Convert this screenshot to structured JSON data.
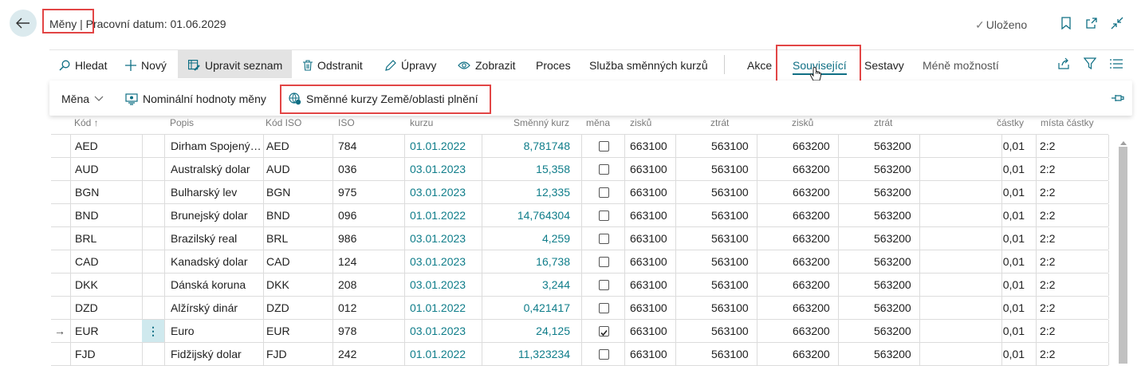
{
  "header": {
    "title": "Měny | Pracovní datum: 01.06.2029",
    "saved_label": "Uloženo"
  },
  "actions": {
    "search": "Hledat",
    "new": "Nový",
    "edit_list": "Upravit seznam",
    "delete": "Odstranit",
    "edit": "Úpravy",
    "view": "Zobrazit",
    "process": "Proces",
    "exchange_service": "Služba směnných kurzů",
    "actions": "Akce",
    "related": "Související",
    "reports": "Sestavy",
    "fewer_options": "Méně možností"
  },
  "subactions": {
    "currency": "Měna",
    "denominations": "Nominální hodnoty měny",
    "country_rates": "Směnné kurzy Země/oblasti plnění"
  },
  "columns": {
    "code": "Kód ↑",
    "description": "Popis",
    "iso_code": "Kód ISO",
    "iso": "ISO",
    "rate_date": "kurzu",
    "exchange_rate": "Směnný kurz",
    "currency_flag": "měna",
    "gain1": "zisků",
    "loss1": "ztrát",
    "gain2": "zisků",
    "loss2": "ztrát",
    "amount": "částky",
    "places": "místa částky"
  },
  "rows": [
    {
      "code": "AED",
      "desc": "Dirham Spojený…",
      "iso_code": "AED",
      "iso": "784",
      "date": "01.01.2022",
      "rate": "8,781748",
      "checked": false,
      "g1": "663100",
      "l1": "563100",
      "g2": "663200",
      "l2": "563200",
      "amt": "0,01",
      "places": "2:2"
    },
    {
      "code": "AUD",
      "desc": "Australský dolar",
      "iso_code": "AUD",
      "iso": "036",
      "date": "03.01.2023",
      "rate": "15,358",
      "checked": false,
      "g1": "663100",
      "l1": "563100",
      "g2": "663200",
      "l2": "563200",
      "amt": "0,01",
      "places": "2:2"
    },
    {
      "code": "BGN",
      "desc": "Bulharský lev",
      "iso_code": "BGN",
      "iso": "975",
      "date": "03.01.2023",
      "rate": "12,335",
      "checked": false,
      "g1": "663100",
      "l1": "563100",
      "g2": "663200",
      "l2": "563200",
      "amt": "0,01",
      "places": "2:2"
    },
    {
      "code": "BND",
      "desc": "Brunejský dolar",
      "iso_code": "BND",
      "iso": "096",
      "date": "01.01.2022",
      "rate": "14,764304",
      "checked": false,
      "g1": "663100",
      "l1": "563100",
      "g2": "663200",
      "l2": "563200",
      "amt": "0,01",
      "places": "2:2"
    },
    {
      "code": "BRL",
      "desc": "Brazilský real",
      "iso_code": "BRL",
      "iso": "986",
      "date": "03.01.2023",
      "rate": "4,259",
      "checked": false,
      "g1": "663100",
      "l1": "563100",
      "g2": "663200",
      "l2": "563200",
      "amt": "0,01",
      "places": "2:2"
    },
    {
      "code": "CAD",
      "desc": "Kanadský dolar",
      "iso_code": "CAD",
      "iso": "124",
      "date": "03.01.2023",
      "rate": "16,738",
      "checked": false,
      "g1": "663100",
      "l1": "563100",
      "g2": "663200",
      "l2": "563200",
      "amt": "0,01",
      "places": "2:2"
    },
    {
      "code": "DKK",
      "desc": "Dánská koruna",
      "iso_code": "DKK",
      "iso": "208",
      "date": "03.01.2023",
      "rate": "3,244",
      "checked": false,
      "g1": "663100",
      "l1": "563100",
      "g2": "663200",
      "l2": "563200",
      "amt": "0,01",
      "places": "2:2"
    },
    {
      "code": "DZD",
      "desc": "Alžírský dinár",
      "iso_code": "DZD",
      "iso": "012",
      "date": "01.01.2022",
      "rate": "0,421417",
      "checked": false,
      "g1": "663100",
      "l1": "563100",
      "g2": "663200",
      "l2": "563200",
      "amt": "0,01",
      "places": "2:2"
    },
    {
      "code": "EUR",
      "desc": "Euro",
      "iso_code": "EUR",
      "iso": "978",
      "date": "03.01.2023",
      "rate": "24,125",
      "checked": true,
      "g1": "663100",
      "l1": "563100",
      "g2": "663200",
      "l2": "563200",
      "amt": "0,01",
      "places": "2:2",
      "selected": true
    },
    {
      "code": "FJD",
      "desc": "Fidžijský dolar",
      "iso_code": "FJD",
      "iso": "242",
      "date": "01.01.2022",
      "rate": "11,323234",
      "checked": false,
      "g1": "663100",
      "l1": "563100",
      "g2": "663200",
      "l2": "563200",
      "amt": "0,01",
      "places": "2:2"
    }
  ],
  "colors": {
    "accent": "#0f6f84",
    "highlight": "#e24545"
  }
}
